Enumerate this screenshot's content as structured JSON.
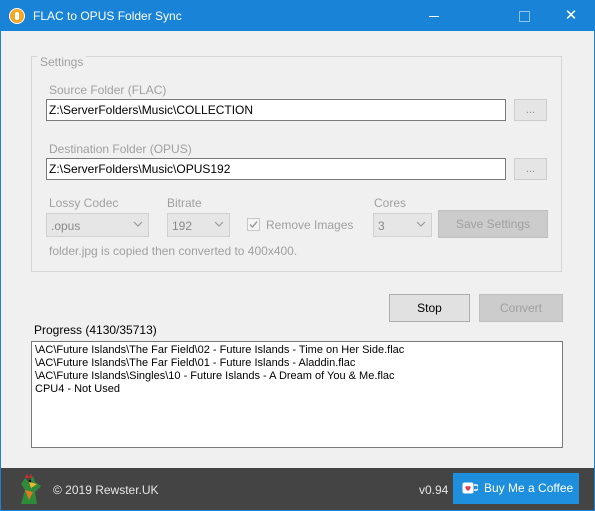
{
  "window": {
    "title": "FLAC to OPUS Folder Sync",
    "controls": {
      "close_glyph": "✕"
    }
  },
  "settings": {
    "legend": "Settings",
    "source_label": "Source Folder (FLAC)",
    "source_value": "Z:\\ServerFolders\\Music\\COLLECTION",
    "source_browse": "...",
    "dest_label": "Destination Folder (OPUS)",
    "dest_value": "Z:\\ServerFolders\\Music\\OPUS192",
    "dest_browse": "...",
    "codec_label": "Lossy Codec",
    "codec_value": ".opus",
    "bitrate_label": "Bitrate",
    "bitrate_value": "192",
    "remove_images_label": "Remove Images",
    "remove_images_checked": true,
    "cores_label": "Cores",
    "cores_value": "3",
    "save_button": "Save Settings",
    "note": "folder.jpg is copied then converted to 400x400."
  },
  "actions": {
    "stop": "Stop",
    "convert": "Convert"
  },
  "progress": {
    "label": "Progress (4130/35713)",
    "log": [
      "\\AC\\Future Islands\\The Far Field\\02 - Future Islands - Time on Her Side.flac",
      "\\AC\\Future Islands\\The Far Field\\01 - Future Islands - Aladdin.flac",
      "\\AC\\Future Islands\\Singles\\10 - Future Islands - A Dream of You & Me.flac",
      "CPU4 - Not Used"
    ]
  },
  "footer": {
    "copyright": "© 2019 Rewster.UK",
    "version": "v0.94",
    "coffee_button": "Buy Me a Coffee"
  },
  "colors": {
    "titlebar": "#1883d7",
    "footer": "#444444",
    "coffee": "#1e8fdc"
  }
}
